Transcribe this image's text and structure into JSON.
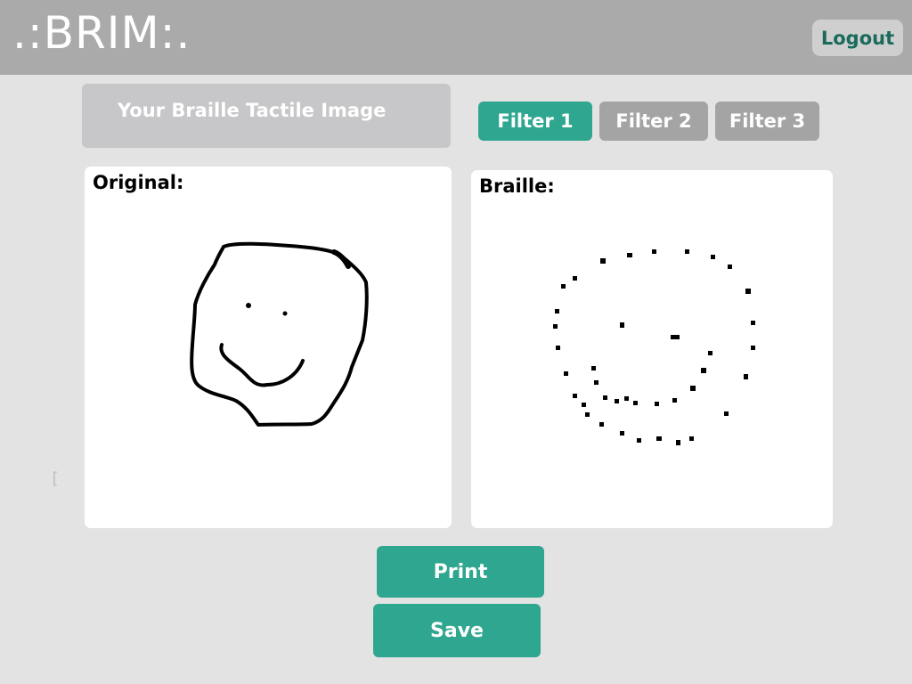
{
  "app": {
    "logo": ".:BRIM:.",
    "logout_label": "Logout"
  },
  "header": {
    "title": "Your Braille Tactile Image"
  },
  "filters": [
    {
      "label": "Filter 1",
      "active": true
    },
    {
      "label": "Filter 2",
      "active": false
    },
    {
      "label": "Filter 3",
      "active": false
    }
  ],
  "original_panel": {
    "label": "Original:"
  },
  "braille_panel": {
    "label": "Braille:"
  },
  "actions": {
    "print_label": "Print",
    "save_label": "Save"
  },
  "side_mark": "[",
  "colors": {
    "accent": "#2fa68f",
    "topbar": "#aaaaaa",
    "inactive": "#a4a4a4",
    "logout_text": "#1a6b5c"
  }
}
